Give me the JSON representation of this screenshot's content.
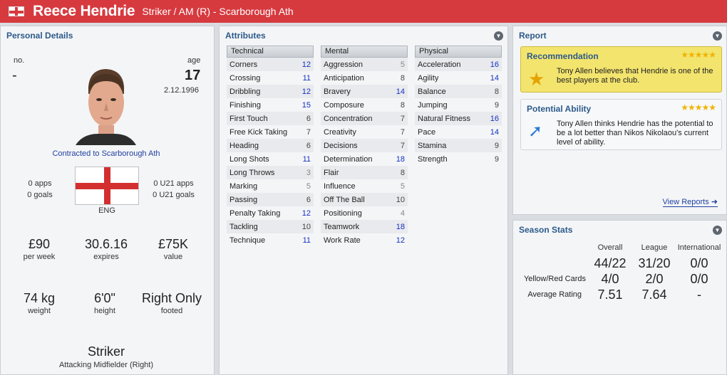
{
  "header": {
    "name": "Reece Hendrie",
    "subtitle": "Striker / AM (R) - Scarborough Ath",
    "accent": "#d63a3f"
  },
  "personal": {
    "title": "Personal Details",
    "no_label": "no.",
    "no_value": "-",
    "age_label": "age",
    "age_value": "17",
    "dob": "2.12.1996",
    "contract": "Contracted to Scarborough Ath",
    "apps": "0 apps",
    "goals": "0 goals",
    "u21_apps": "0 U21 apps",
    "u21_goals": "0 U21 goals",
    "nation": "ENG",
    "wage": "£90",
    "wage_label": "per week",
    "expires": "30.6.16",
    "expires_label": "expires",
    "value": "£75K",
    "value_label": "value",
    "weight": "74 kg",
    "weight_label": "weight",
    "height": "6'0\"",
    "height_label": "height",
    "footed": "Right Only",
    "footed_label": "footed",
    "position": "Striker",
    "position_detail": "Attacking Midfielder (Right)"
  },
  "attributes": {
    "title": "Attributes",
    "technical": {
      "label": "Technical",
      "rows": [
        {
          "name": "Corners",
          "value": "12"
        },
        {
          "name": "Crossing",
          "value": "11"
        },
        {
          "name": "Dribbling",
          "value": "12"
        },
        {
          "name": "Finishing",
          "value": "15"
        },
        {
          "name": "First Touch",
          "value": "6"
        },
        {
          "name": "Free Kick Taking",
          "value": "7"
        },
        {
          "name": "Heading",
          "value": "6"
        },
        {
          "name": "Long Shots",
          "value": "11"
        },
        {
          "name": "Long Throws",
          "value": "3"
        },
        {
          "name": "Marking",
          "value": "5"
        },
        {
          "name": "Passing",
          "value": "6"
        },
        {
          "name": "Penalty Taking",
          "value": "12"
        },
        {
          "name": "Tackling",
          "value": "10"
        },
        {
          "name": "Technique",
          "value": "11"
        }
      ]
    },
    "mental": {
      "label": "Mental",
      "rows": [
        {
          "name": "Aggression",
          "value": "5"
        },
        {
          "name": "Anticipation",
          "value": "8"
        },
        {
          "name": "Bravery",
          "value": "14"
        },
        {
          "name": "Composure",
          "value": "8"
        },
        {
          "name": "Concentration",
          "value": "7"
        },
        {
          "name": "Creativity",
          "value": "7"
        },
        {
          "name": "Decisions",
          "value": "7"
        },
        {
          "name": "Determination",
          "value": "18"
        },
        {
          "name": "Flair",
          "value": "8"
        },
        {
          "name": "Influence",
          "value": "5"
        },
        {
          "name": "Off The Ball",
          "value": "10"
        },
        {
          "name": "Positioning",
          "value": "4"
        },
        {
          "name": "Teamwork",
          "value": "18"
        },
        {
          "name": "Work Rate",
          "value": "12"
        }
      ]
    },
    "physical": {
      "label": "Physical",
      "rows": [
        {
          "name": "Acceleration",
          "value": "16"
        },
        {
          "name": "Agility",
          "value": "14"
        },
        {
          "name": "Balance",
          "value": "8"
        },
        {
          "name": "Jumping",
          "value": "9"
        },
        {
          "name": "Natural Fitness",
          "value": "16"
        },
        {
          "name": "Pace",
          "value": "14"
        },
        {
          "name": "Stamina",
          "value": "9"
        },
        {
          "name": "Strength",
          "value": "9"
        }
      ]
    }
  },
  "report": {
    "title": "Report",
    "recommendation": {
      "title": "Recommendation",
      "stars": "★★★★★",
      "text": "Tony Allen believes that Hendrie is one of the best players at the club."
    },
    "potential": {
      "title": "Potential Ability",
      "stars": "★★★★★",
      "text": "Tony Allen thinks Hendrie has the potential to be a lot better than Nikos Nikolaou's current level of ability."
    },
    "view_reports": "View Reports ➜"
  },
  "season": {
    "title": "Season Stats",
    "headers": [
      "Overall",
      "League",
      "International"
    ],
    "apps": [
      "44/22",
      "31/20",
      "0/0"
    ],
    "cards_label": "Yellow/Red Cards",
    "cards": [
      "4/0",
      "2/0",
      "0/0"
    ],
    "rating_label": "Average Rating",
    "rating": [
      "7.51",
      "7.64",
      "-"
    ]
  }
}
